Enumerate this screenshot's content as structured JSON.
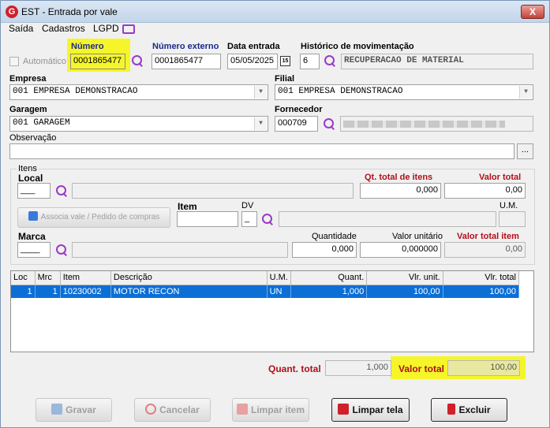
{
  "window": {
    "title": "EST - Entrada por vale",
    "close_glyph": "X"
  },
  "menu": [
    "Saída",
    "Cadastros",
    "LGPD"
  ],
  "header": {
    "automatico_label": "Automático",
    "numero_label": "Número",
    "numero_value": "0001865477",
    "numero_externo_label": "Número externo",
    "numero_externo_value": "0001865477",
    "data_entrada_label": "Data entrada",
    "data_entrada_value": "05/05/2025",
    "calendar_glyph": "15",
    "historico_label": "Histórico de movimentação",
    "historico_code": "6",
    "historico_value": "RECUPERACAO DE MATERIAL"
  },
  "empresa": {
    "label": "Empresa",
    "value": "001 EMPRESA DEMONSTRACAO"
  },
  "filial": {
    "label": "Filial",
    "value": "001 EMPRESA DEMONSTRACAO"
  },
  "garagem": {
    "label": "Garagem",
    "value": "001 GARAGEM"
  },
  "fornecedor": {
    "label": "Fornecedor",
    "code": "000709",
    "name": ""
  },
  "observacao": {
    "label": "Observação",
    "value": "",
    "ellipsis": "..."
  },
  "itens": {
    "group_label": "Itens",
    "local_label": "Local",
    "local_code": "___",
    "qt_total_label": "Qt. total de itens",
    "qt_total_value": "0,000",
    "valor_total_label": "Valor total",
    "valor_total_value": "0,00",
    "associa_label": "Associa vale / Pedido de compras",
    "item_label": "Item",
    "dv_label": "DV",
    "dv_value": "_",
    "um_label": "U.M.",
    "marca_label": "Marca",
    "marca_code": "____",
    "quantidade_label": "Quantidade",
    "quantidade_value": "0,000",
    "valor_unitario_label": "Valor unitário",
    "valor_unitario_value": "0,000000",
    "valor_total_item_label": "Valor total item",
    "valor_total_item_value": "0,00"
  },
  "grid": {
    "columns": [
      "Loc",
      "Mrc",
      "Item",
      "Descrição",
      "U.M.",
      "Quant.",
      "Vlr. unit.",
      "Vlr. total"
    ],
    "rows": [
      [
        "1",
        "1",
        "10230002",
        "MOTOR RECON",
        "UN",
        "1,000",
        "100,00",
        "100,00"
      ]
    ]
  },
  "totals": {
    "quant_total_label": "Quant. total",
    "quant_total_value": "1,000",
    "valor_total_label": "Valor total",
    "valor_total_value": "100,00"
  },
  "buttons": {
    "gravar": "Gravar",
    "cancelar": "Cancelar",
    "limpar_item": "Limpar item",
    "limpar_tela": "Limpar tela",
    "excluir": "Excluir"
  },
  "colors": {
    "highlight": "#f5f52a",
    "selection": "#0b6fd6",
    "label_red": "#b0101a",
    "label_blue": "#1a2a8a",
    "search_icon": "#9a3ac8"
  }
}
